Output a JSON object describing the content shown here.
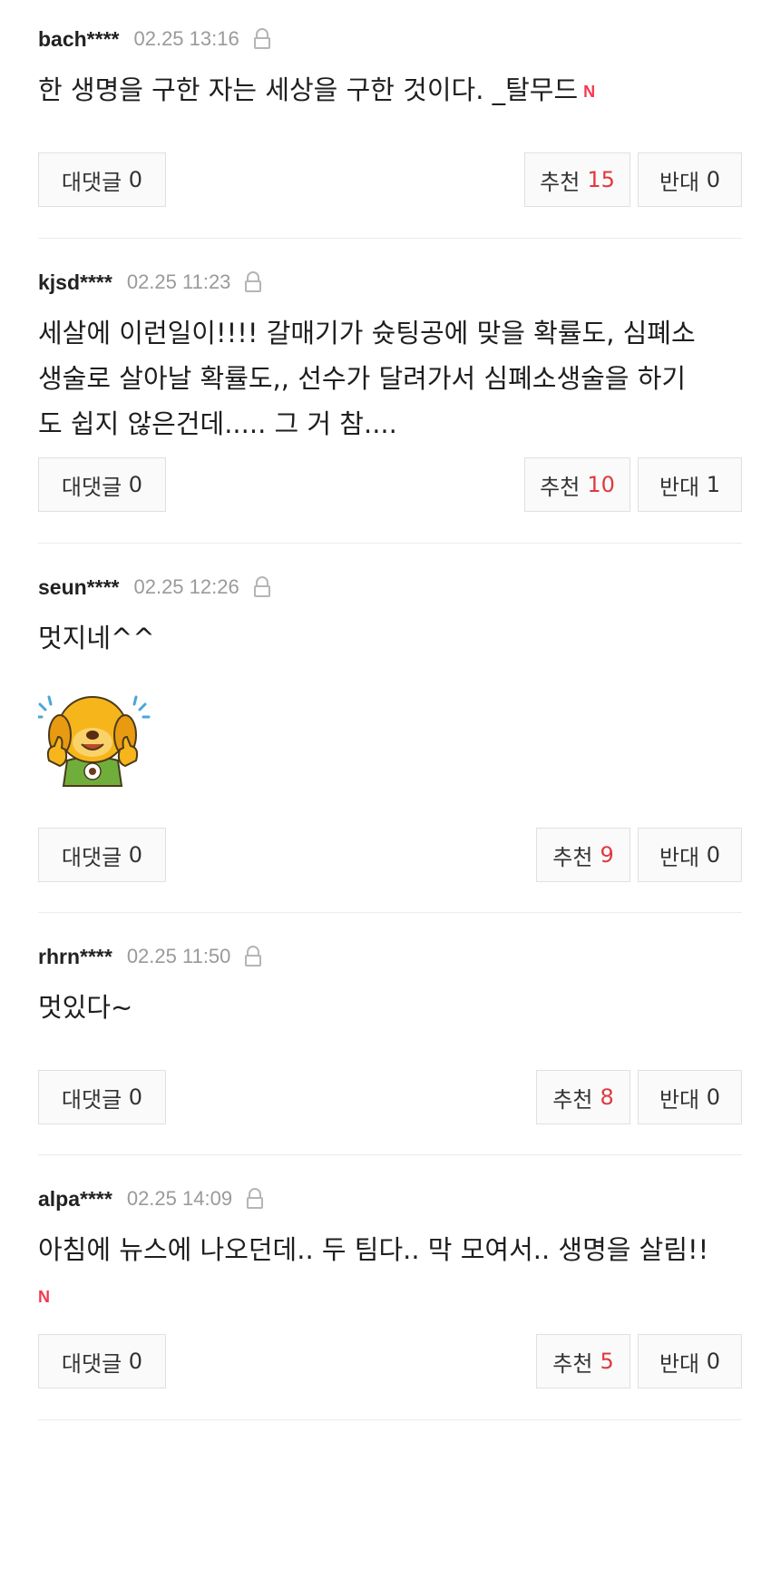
{
  "labels": {
    "reply": "대댓글",
    "recommend": "추천",
    "against": "반대"
  },
  "new_badge": "N",
  "colors": {
    "count": "#e0393e",
    "new_badge": "#f5374f"
  },
  "comments": [
    {
      "user": "bach****",
      "date": "02.25 13:16",
      "text": "한 생명을 구한 자는 세상을 구한 것이다. _탈무드",
      "replies": "0",
      "recommend": "15",
      "against": "0"
    },
    {
      "user": "kjsd****",
      "date": "02.25 11:23",
      "text": "세살에 이런일이!!!! 갈매기가 슛팅공에 맞을 확률도, 심폐소\n생술로 살아날 확률도,, 선수가 달려가서 심폐소생술을 하기\n도 쉽지 않은건데..... 그 거 참....",
      "replies": "0",
      "recommend": "10",
      "against": "1"
    },
    {
      "user": "seun****",
      "date": "02.25 12:26",
      "text": "멋지네^^",
      "sticker": "thumbs-up-dog-sticker",
      "replies": "0",
      "recommend": "9",
      "against": "0"
    },
    {
      "user": "rhrn****",
      "date": "02.25 11:50",
      "text": "멋있다~",
      "replies": "0",
      "recommend": "8",
      "against": "0"
    },
    {
      "user": "alpa****",
      "date": "02.25 14:09",
      "text": "아침에 뉴스에 나오던데.. 두 팀다.. 막 모여서.. 생명을 살림!!",
      "replies": "0",
      "recommend": "5",
      "against": "0"
    }
  ]
}
